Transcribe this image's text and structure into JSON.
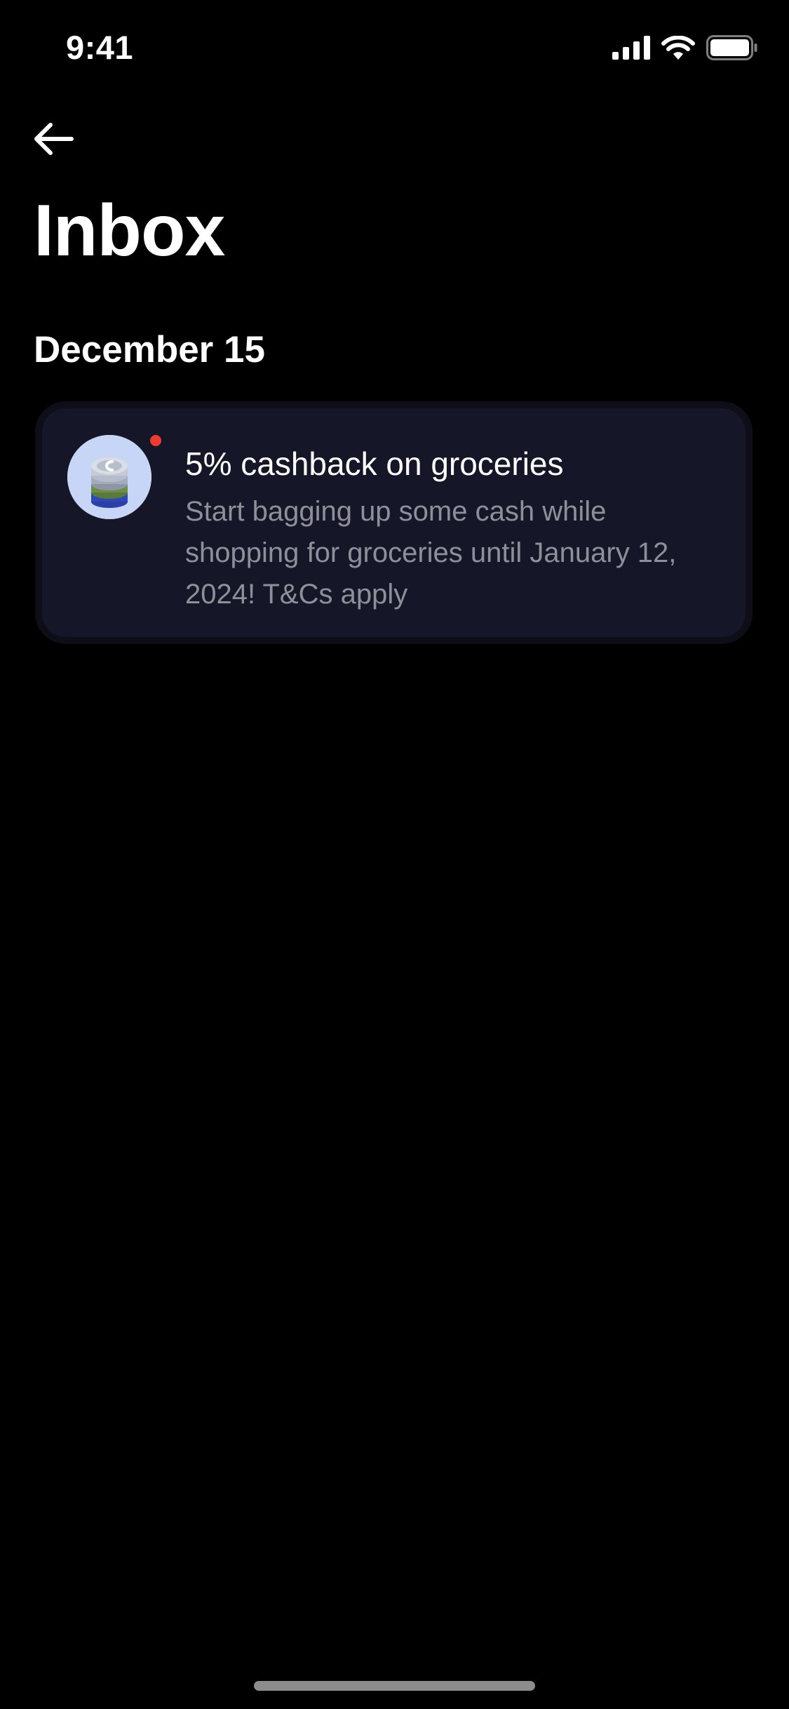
{
  "status_bar": {
    "time": "9:41",
    "icons": [
      "signal-icon",
      "wifi-icon",
      "battery-icon"
    ]
  },
  "header": {
    "back_icon": "arrow-left-icon",
    "title": "Inbox"
  },
  "sections": [
    {
      "date": "December 15",
      "notifications": [
        {
          "icon": "cashback-coins-icon",
          "unread": true,
          "title": "5% cashback on groceries",
          "body": "Start bagging up some cash while shopping for groceries until January 12, 2024! T&Cs apply"
        }
      ]
    }
  ],
  "colors": {
    "background": "#000000",
    "card_background": "#161629",
    "unread_dot": "#ef3b2f",
    "body_text": "#8f8f99"
  }
}
